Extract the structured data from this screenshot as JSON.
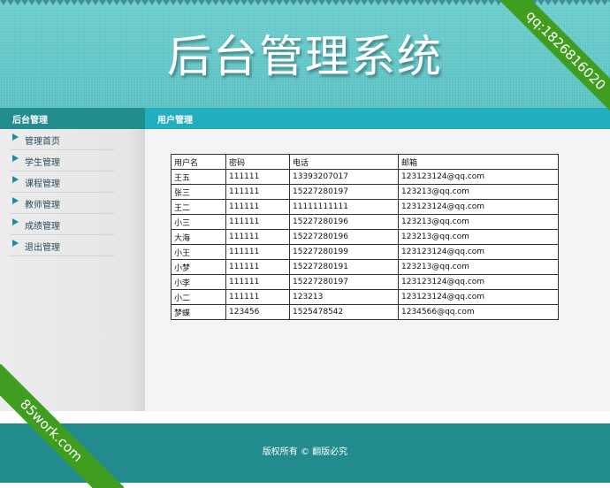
{
  "header": {
    "site_title": "后台管理系统"
  },
  "titlebar": {
    "left_title": "后台管理",
    "right_title": "用户管理"
  },
  "sidebar": {
    "items": [
      {
        "label": "管理首页"
      },
      {
        "label": "学生管理"
      },
      {
        "label": "课程管理"
      },
      {
        "label": "教师管理"
      },
      {
        "label": "成绩管理"
      },
      {
        "label": "退出管理"
      }
    ]
  },
  "table": {
    "headers": [
      "用户名",
      "密码",
      "电话",
      "邮箱"
    ],
    "rows": [
      [
        "王五",
        "111111",
        "13393207017",
        "123123124@qq.com"
      ],
      [
        "张三",
        "111111",
        "15227280197",
        "123213@qq.com"
      ],
      [
        "王二",
        "111111",
        "11111111111",
        "123123124@qq.com"
      ],
      [
        "小三",
        "111111",
        "15227280196",
        "123213@qq.com"
      ],
      [
        "大海",
        "111111",
        "15227280196",
        "123213@qq.com"
      ],
      [
        "小王",
        "111111",
        "15227280199",
        "123123124@qq.com"
      ],
      [
        "小梦",
        "111111",
        "15227280191",
        "123213@qq.com"
      ],
      [
        "小李",
        "111111",
        "15227280197",
        "123123124@qq.com"
      ],
      [
        "小二",
        "111111",
        "123213",
        "123123124@qq.com"
      ],
      [
        "梦蝶",
        "123456",
        "1525478542",
        "1234566@qq.com"
      ]
    ]
  },
  "footer": {
    "copyright": "版权所有 © 翻版必究"
  },
  "ribbons": {
    "top_right": "qq:1826816020",
    "bottom_left": "85work.com"
  },
  "colors": {
    "header_bg": "#5ec6c6",
    "titlebar_bg": "#22aebf",
    "titlebar_left_bg": "#238c8f",
    "footer_bg": "#228b8e",
    "ribbon_bg": "#3f9e1f"
  }
}
